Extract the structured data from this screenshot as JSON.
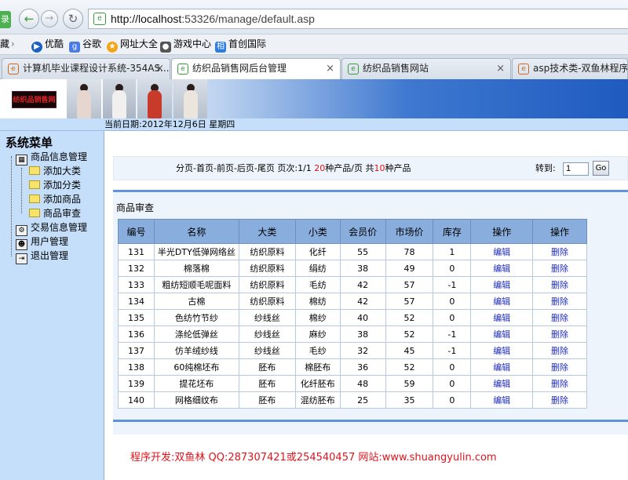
{
  "browser": {
    "green_tab_label": "录",
    "url_host": "http://localhost",
    "url_rest": ":53326/manage/default.asp",
    "bookmarks": [
      {
        "label": "藏",
        "icon": "bookmark-icon",
        "color": "#888888"
      },
      {
        "label": "优酷",
        "icon": "play-icon",
        "color": "#1b62c4"
      },
      {
        "label": "谷歌",
        "icon": "google-icon",
        "color": "#4a7ae8"
      },
      {
        "label": "网址大全",
        "icon": "star-icon",
        "color": "#f2a516"
      },
      {
        "label": "游戏中心",
        "icon": "gamepad-icon",
        "color": "#555555"
      },
      {
        "label": "首创国际",
        "icon": "brand-icon",
        "color": "#2d7de0"
      }
    ],
    "tabs": [
      {
        "title": "计算机毕业课程设计系统-354AS...",
        "close": "×"
      },
      {
        "title": "纺织品销售网后台管理",
        "close": "×"
      },
      {
        "title": "纺织品销售网站",
        "close": "×"
      },
      {
        "title": "asp技术类-双鱼林程序设"
      }
    ]
  },
  "banner": {
    "logo_text": "纺织品销售网"
  },
  "date_bar": {
    "text": "当前日期:2012年12月6日 星期四"
  },
  "sidebar": {
    "title": "系统菜单",
    "groups": [
      {
        "label": "商品信息管理",
        "icon": "product-management-icon"
      },
      {
        "label": "添加大类",
        "icon": "folder-icon"
      },
      {
        "label": "添加分类",
        "icon": "folder-icon"
      },
      {
        "label": "添加商品",
        "icon": "folder-icon"
      },
      {
        "label": "商品审查",
        "icon": "folder-icon"
      },
      {
        "label": "交易信息管理",
        "icon": "transaction-icon"
      },
      {
        "label": "用户管理",
        "icon": "user-icon"
      },
      {
        "label": "退出管理",
        "icon": "exit-icon"
      }
    ]
  },
  "pager": {
    "prefix": "分页-首页-前页-后页-尾页   页次:1/1 ",
    "per_page": "20",
    "middle": "种产品/页 共",
    "total": "10",
    "suffix": "种产品",
    "goto_label": "转到:",
    "goto_value": "1",
    "go_label": "Go"
  },
  "panel": {
    "title": "商品审查"
  },
  "table": {
    "headers": [
      "编号",
      "名称",
      "大类",
      "小类",
      "会员价",
      "市场价",
      "库存",
      "操作",
      "操作"
    ],
    "rows": [
      [
        "131",
        "半光DTY低弹网络丝",
        "纺织原料",
        "化纤",
        "55",
        "78",
        "1",
        "编辑",
        "删除"
      ],
      [
        "132",
        "棉落棉",
        "纺织原料",
        "绢纺",
        "38",
        "49",
        "0",
        "编辑",
        "删除"
      ],
      [
        "133",
        "粗纺短顺毛呢面料",
        "纺织原料",
        "毛纺",
        "42",
        "57",
        "-1",
        "编辑",
        "删除"
      ],
      [
        "134",
        "古棉",
        "纺织原料",
        "棉纺",
        "42",
        "57",
        "0",
        "编辑",
        "删除"
      ],
      [
        "135",
        "色纺竹节纱",
        "纱线丝",
        "棉纱",
        "40",
        "52",
        "0",
        "编辑",
        "删除"
      ],
      [
        "136",
        "涤纶低弹丝",
        "纱线丝",
        "麻纱",
        "38",
        "52",
        "-1",
        "编辑",
        "删除"
      ],
      [
        "137",
        "仿羊绒纱线",
        "纱线丝",
        "毛纱",
        "32",
        "45",
        "-1",
        "编辑",
        "删除"
      ],
      [
        "138",
        "60纯棉坯布",
        "胚布",
        "棉胚布",
        "36",
        "52",
        "0",
        "编辑",
        "删除"
      ],
      [
        "139",
        "提花坯布",
        "胚布",
        "化纤胚布",
        "48",
        "59",
        "0",
        "编辑",
        "删除"
      ],
      [
        "140",
        "网格细纹布",
        "胚布",
        "混纺胚布",
        "25",
        "35",
        "0",
        "编辑",
        "删除"
      ]
    ]
  },
  "footer": {
    "text": "程序开发:双鱼林 QQ:287307421或254540457 网站:www.shuangyulin.com"
  },
  "colors": {
    "accent": "#5f95d8",
    "header_row": "#89aede",
    "sidebar_bg": "#c5defa",
    "link": "#1d2bbf",
    "highlight": "#e0141c"
  }
}
